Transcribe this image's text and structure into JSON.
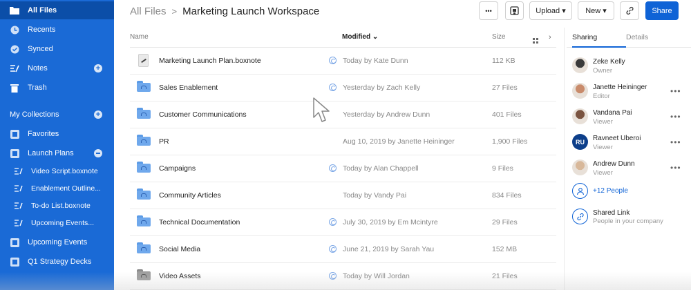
{
  "sidebar": {
    "items": [
      {
        "label": "All Files",
        "icon": "folder-icon",
        "active": true
      },
      {
        "label": "Recents",
        "icon": "clock-icon"
      },
      {
        "label": "Synced",
        "icon": "check-circle-icon"
      },
      {
        "label": "Notes",
        "icon": "notes-icon",
        "has_plus": true
      },
      {
        "label": "Trash",
        "icon": "trash-icon"
      }
    ],
    "collections_title": "My Collections",
    "collections": [
      {
        "label": "Favorites",
        "icon": "collection-icon"
      },
      {
        "label": "Launch Plans",
        "icon": "collection-icon"
      },
      {
        "label": "Video Script.boxnote",
        "icon": "note-icon"
      },
      {
        "label": "Enablement Outline...",
        "icon": "note-icon"
      },
      {
        "label": "To-do List.boxnote",
        "icon": "note-icon"
      },
      {
        "label": "Upcoming Events...",
        "icon": "note-icon"
      },
      {
        "label": "Upcoming Events",
        "icon": "collection-icon"
      },
      {
        "label": "Q1 Strategy Decks",
        "icon": "collection-icon"
      }
    ]
  },
  "breadcrumb": {
    "root": "All Files",
    "separator": ">",
    "current": "Marketing Launch Workspace"
  },
  "toolbar": {
    "more": "•••",
    "upload": "Upload ▾",
    "new": "New ▾",
    "share": "Share"
  },
  "columns": {
    "name": "Name",
    "modified": "Modified",
    "modified_arrow": "⌄",
    "size": "Size"
  },
  "files": [
    {
      "name": "Marketing Launch Plan.boxnote",
      "type": "boxnote",
      "synced": true,
      "modified": "Today by Kate Dunn",
      "size": "112 KB"
    },
    {
      "name": "Sales Enablement",
      "type": "folder",
      "synced": true,
      "modified": "Yesterday by Zach Kelly",
      "size": "27 Files"
    },
    {
      "name": "Customer Communications",
      "type": "folder",
      "synced": false,
      "modified": "Yesterday by Andrew Dunn",
      "size": "401 Files"
    },
    {
      "name": "PR",
      "type": "folder",
      "synced": false,
      "modified": "Aug 10, 2019 by Janette Heininger",
      "size": "1,900 Files"
    },
    {
      "name": "Campaigns",
      "type": "folder",
      "synced": true,
      "modified": "Today by Alan Chappell",
      "size": "9 Files"
    },
    {
      "name": "Community Articles",
      "type": "folder",
      "synced": false,
      "modified": "Today by Vandy Pai",
      "size": "834 Files"
    },
    {
      "name": "Technical Documentation",
      "type": "folder",
      "synced": true,
      "modified": "July 30, 2019 by Em Mcintyre",
      "size": "29 Files"
    },
    {
      "name": "Social Media",
      "type": "folder",
      "synced": true,
      "modified": "June 21, 2019 by Sarah Yau",
      "size": "152 MB"
    },
    {
      "name": "Video Assets",
      "type": "folder-grey",
      "synced": true,
      "modified": "Today by Will Jordan",
      "size": "21 Files"
    }
  ],
  "right_panel": {
    "tabs": [
      "Sharing",
      "Details"
    ],
    "people": [
      {
        "name": "Zeke Kelly",
        "role": "Owner",
        "avatar_color": "#3a3a3a",
        "more": false
      },
      {
        "name": "Janette Heininger",
        "role": "Editor",
        "avatar_color": "#c98b6b",
        "more": true
      },
      {
        "name": "Vandana Pai",
        "role": "Viewer",
        "avatar_color": "#7a5340",
        "more": true
      },
      {
        "name": "Ravneet Uberoi",
        "role": "Viewer",
        "initials": "RU",
        "more": true
      },
      {
        "name": "Andrew Dunn",
        "role": "Viewer",
        "avatar_color": "#d8b89a",
        "more": true
      }
    ],
    "more_people": "+12 People",
    "shared_link_title": "Shared Link",
    "shared_link_sub": "People in your company"
  },
  "colors": {
    "sidebar": "#1a6ad6",
    "accent": "#0f63d6"
  }
}
